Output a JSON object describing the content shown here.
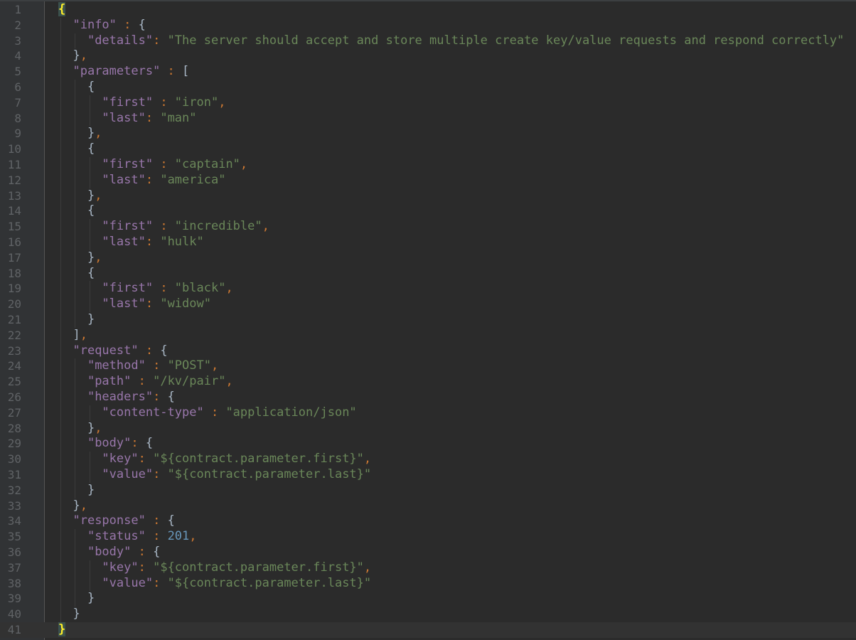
{
  "editor": {
    "colors": {
      "background": "#2b2b2b",
      "gutter": "#313335",
      "line_number": "#606366",
      "key": "#9876aa",
      "string": "#6a8759",
      "number": "#6897bb",
      "punctuation": "#cc7832",
      "brace": "#a9b7c6",
      "brace_match": "#ffef28"
    },
    "current_line": 41,
    "lines": [
      [
        {
          "t": "{",
          "c": "match"
        }
      ],
      [
        {
          "t": "  "
        },
        {
          "t": "\"info\"",
          "c": "key"
        },
        {
          "t": " : ",
          "c": "punc"
        },
        {
          "t": "{",
          "c": "brace"
        }
      ],
      [
        {
          "t": "    "
        },
        {
          "t": "\"details\"",
          "c": "key"
        },
        {
          "t": ": ",
          "c": "punc"
        },
        {
          "t": "\"The server should accept and store multiple create key/value requests and respond correctly\"",
          "c": "str"
        }
      ],
      [
        {
          "t": "  "
        },
        {
          "t": "}",
          "c": "brace"
        },
        {
          "t": ",",
          "c": "punc"
        }
      ],
      [
        {
          "t": "  "
        },
        {
          "t": "\"parameters\"",
          "c": "key"
        },
        {
          "t": " : ",
          "c": "punc"
        },
        {
          "t": "[",
          "c": "brace"
        }
      ],
      [
        {
          "t": "    "
        },
        {
          "t": "{",
          "c": "brace"
        }
      ],
      [
        {
          "t": "      "
        },
        {
          "t": "\"first\"",
          "c": "key"
        },
        {
          "t": " : ",
          "c": "punc"
        },
        {
          "t": "\"iron\"",
          "c": "str"
        },
        {
          "t": ",",
          "c": "punc"
        }
      ],
      [
        {
          "t": "      "
        },
        {
          "t": "\"last\"",
          "c": "key"
        },
        {
          "t": ": ",
          "c": "punc"
        },
        {
          "t": "\"man\"",
          "c": "str"
        }
      ],
      [
        {
          "t": "    "
        },
        {
          "t": "}",
          "c": "brace"
        },
        {
          "t": ",",
          "c": "punc"
        }
      ],
      [
        {
          "t": "    "
        },
        {
          "t": "{",
          "c": "brace"
        }
      ],
      [
        {
          "t": "      "
        },
        {
          "t": "\"first\"",
          "c": "key"
        },
        {
          "t": " : ",
          "c": "punc"
        },
        {
          "t": "\"captain\"",
          "c": "str"
        },
        {
          "t": ",",
          "c": "punc"
        }
      ],
      [
        {
          "t": "      "
        },
        {
          "t": "\"last\"",
          "c": "key"
        },
        {
          "t": ": ",
          "c": "punc"
        },
        {
          "t": "\"america\"",
          "c": "str"
        }
      ],
      [
        {
          "t": "    "
        },
        {
          "t": "}",
          "c": "brace"
        },
        {
          "t": ",",
          "c": "punc"
        }
      ],
      [
        {
          "t": "    "
        },
        {
          "t": "{",
          "c": "brace"
        }
      ],
      [
        {
          "t": "      "
        },
        {
          "t": "\"first\"",
          "c": "key"
        },
        {
          "t": " : ",
          "c": "punc"
        },
        {
          "t": "\"incredible\"",
          "c": "str"
        },
        {
          "t": ",",
          "c": "punc"
        }
      ],
      [
        {
          "t": "      "
        },
        {
          "t": "\"last\"",
          "c": "key"
        },
        {
          "t": ": ",
          "c": "punc"
        },
        {
          "t": "\"hulk\"",
          "c": "str"
        }
      ],
      [
        {
          "t": "    "
        },
        {
          "t": "}",
          "c": "brace"
        },
        {
          "t": ",",
          "c": "punc"
        }
      ],
      [
        {
          "t": "    "
        },
        {
          "t": "{",
          "c": "brace"
        }
      ],
      [
        {
          "t": "      "
        },
        {
          "t": "\"first\"",
          "c": "key"
        },
        {
          "t": " : ",
          "c": "punc"
        },
        {
          "t": "\"black\"",
          "c": "str"
        },
        {
          "t": ",",
          "c": "punc"
        }
      ],
      [
        {
          "t": "      "
        },
        {
          "t": "\"last\"",
          "c": "key"
        },
        {
          "t": ": ",
          "c": "punc"
        },
        {
          "t": "\"widow\"",
          "c": "str"
        }
      ],
      [
        {
          "t": "    "
        },
        {
          "t": "}",
          "c": "brace"
        }
      ],
      [
        {
          "t": "  "
        },
        {
          "t": "]",
          "c": "brace"
        },
        {
          "t": ",",
          "c": "punc"
        }
      ],
      [
        {
          "t": "  "
        },
        {
          "t": "\"request\"",
          "c": "key"
        },
        {
          "t": " : ",
          "c": "punc"
        },
        {
          "t": "{",
          "c": "brace"
        }
      ],
      [
        {
          "t": "    "
        },
        {
          "t": "\"method\"",
          "c": "key"
        },
        {
          "t": " : ",
          "c": "punc"
        },
        {
          "t": "\"POST\"",
          "c": "str"
        },
        {
          "t": ",",
          "c": "punc"
        }
      ],
      [
        {
          "t": "    "
        },
        {
          "t": "\"path\"",
          "c": "key"
        },
        {
          "t": " : ",
          "c": "punc"
        },
        {
          "t": "\"/kv/pair\"",
          "c": "str"
        },
        {
          "t": ",",
          "c": "punc"
        }
      ],
      [
        {
          "t": "    "
        },
        {
          "t": "\"headers\"",
          "c": "key"
        },
        {
          "t": ": ",
          "c": "punc"
        },
        {
          "t": "{",
          "c": "brace"
        }
      ],
      [
        {
          "t": "      "
        },
        {
          "t": "\"content-type\"",
          "c": "key"
        },
        {
          "t": " : ",
          "c": "punc"
        },
        {
          "t": "\"application/json\"",
          "c": "str"
        }
      ],
      [
        {
          "t": "    "
        },
        {
          "t": "}",
          "c": "brace"
        },
        {
          "t": ",",
          "c": "punc"
        }
      ],
      [
        {
          "t": "    "
        },
        {
          "t": "\"body\"",
          "c": "key"
        },
        {
          "t": ": ",
          "c": "punc"
        },
        {
          "t": "{",
          "c": "brace"
        }
      ],
      [
        {
          "t": "      "
        },
        {
          "t": "\"key\"",
          "c": "key"
        },
        {
          "t": ": ",
          "c": "punc"
        },
        {
          "t": "\"${contract.parameter.first}\"",
          "c": "str"
        },
        {
          "t": ",",
          "c": "punc"
        }
      ],
      [
        {
          "t": "      "
        },
        {
          "t": "\"value\"",
          "c": "key"
        },
        {
          "t": ": ",
          "c": "punc"
        },
        {
          "t": "\"${contract.parameter.last}\"",
          "c": "str"
        }
      ],
      [
        {
          "t": "    "
        },
        {
          "t": "}",
          "c": "brace"
        }
      ],
      [
        {
          "t": "  "
        },
        {
          "t": "}",
          "c": "brace"
        },
        {
          "t": ",",
          "c": "punc"
        }
      ],
      [
        {
          "t": "  "
        },
        {
          "t": "\"response\"",
          "c": "key"
        },
        {
          "t": " : ",
          "c": "punc"
        },
        {
          "t": "{",
          "c": "brace"
        }
      ],
      [
        {
          "t": "    "
        },
        {
          "t": "\"status\"",
          "c": "key"
        },
        {
          "t": " : ",
          "c": "punc"
        },
        {
          "t": "201",
          "c": "num"
        },
        {
          "t": ",",
          "c": "punc"
        }
      ],
      [
        {
          "t": "    "
        },
        {
          "t": "\"body\"",
          "c": "key"
        },
        {
          "t": " : ",
          "c": "punc"
        },
        {
          "t": "{",
          "c": "brace"
        }
      ],
      [
        {
          "t": "      "
        },
        {
          "t": "\"key\"",
          "c": "key"
        },
        {
          "t": ": ",
          "c": "punc"
        },
        {
          "t": "\"${contract.parameter.first}\"",
          "c": "str"
        },
        {
          "t": ",",
          "c": "punc"
        }
      ],
      [
        {
          "t": "      "
        },
        {
          "t": "\"value\"",
          "c": "key"
        },
        {
          "t": ": ",
          "c": "punc"
        },
        {
          "t": "\"${contract.parameter.last}\"",
          "c": "str"
        }
      ],
      [
        {
          "t": "    "
        },
        {
          "t": "}",
          "c": "brace"
        }
      ],
      [
        {
          "t": "  "
        },
        {
          "t": "}",
          "c": "brace"
        }
      ],
      [
        {
          "t": "}",
          "c": "match"
        }
      ]
    ]
  }
}
